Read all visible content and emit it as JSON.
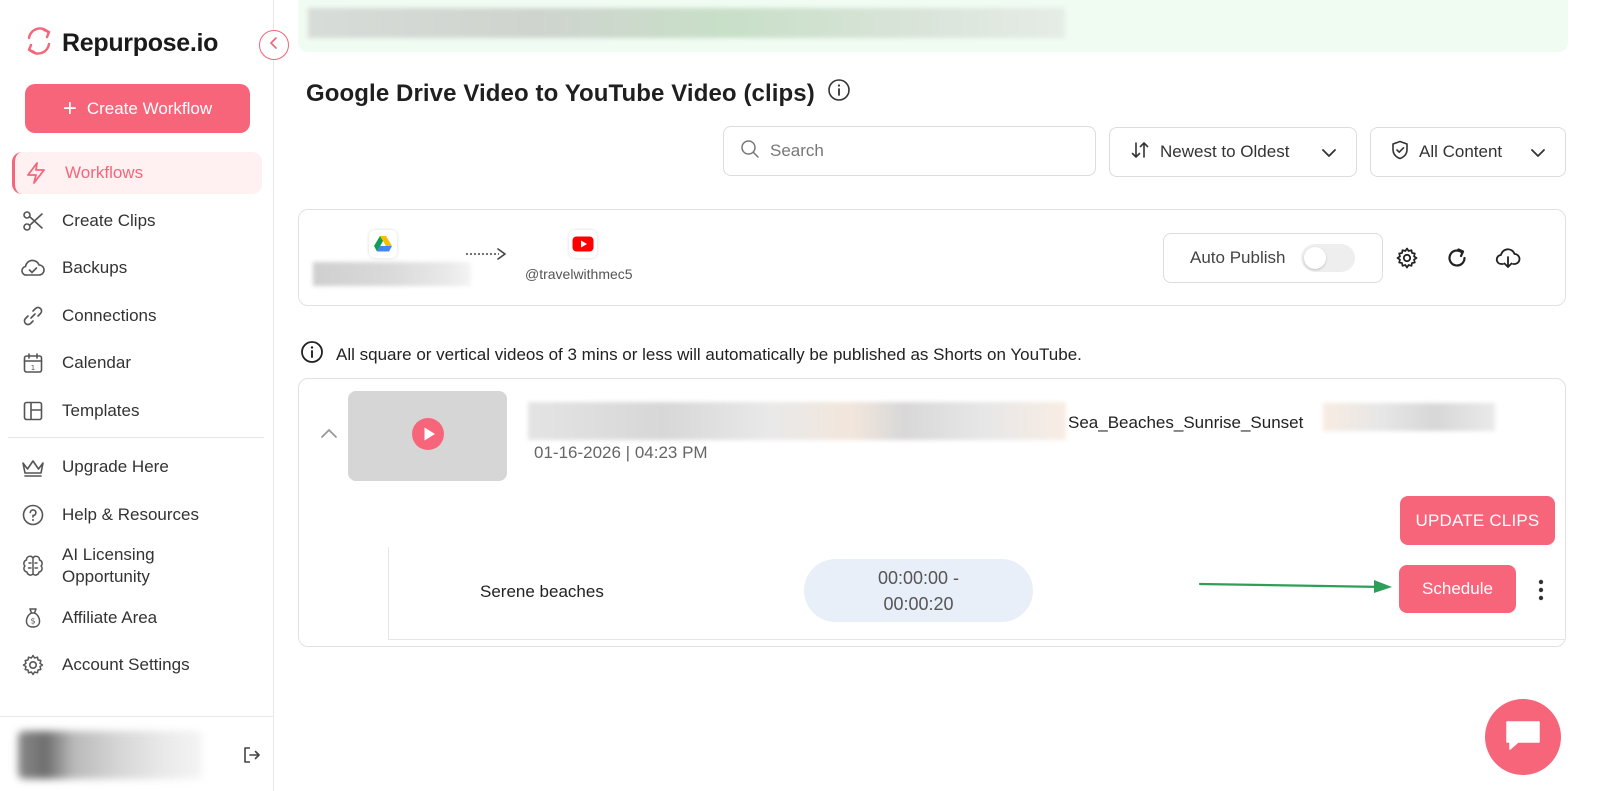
{
  "brand": {
    "name": "Repurpose.io"
  },
  "sidebar": {
    "create_label": "Create Workflow",
    "items": [
      {
        "label": "Workflows"
      },
      {
        "label": "Create Clips"
      },
      {
        "label": "Backups"
      },
      {
        "label": "Connections"
      },
      {
        "label": "Calendar"
      },
      {
        "label": "Templates"
      },
      {
        "label": "Upgrade Here"
      },
      {
        "label": "Help & Resources"
      },
      {
        "label": "AI Licensing"
      },
      {
        "label": "Opportunity"
      },
      {
        "label": "Affiliate Area"
      },
      {
        "label": "Account Settings"
      }
    ]
  },
  "main": {
    "title": "Google Drive Video to YouTube Video (clips)",
    "search_placeholder": "Search",
    "sort_label": "Newest to Oldest",
    "filter_label": "All Content",
    "workflow": {
      "destination_handle": "@travelwithmec5",
      "auto_publish_label": "Auto Publish",
      "auto_publish_on": false
    },
    "info_note": "All square or vertical videos of 3 mins or less will automatically be published as Shorts on YouTube.",
    "video": {
      "title": "Sea_Beaches_Sunrise_Sunset",
      "date": "01-16-2026 | 04:23 PM",
      "update_label": "UPDATE CLIPS",
      "clip": {
        "name": "Serene beaches",
        "time_start": "00:00:00 -",
        "time_end": "00:00:20",
        "schedule_label": "Schedule"
      }
    }
  },
  "colors": {
    "accent": "#f7657a",
    "banner": "#f0fbf2",
    "pill": "#e9eff8",
    "annotation_arrow": "#2e9e5b"
  }
}
